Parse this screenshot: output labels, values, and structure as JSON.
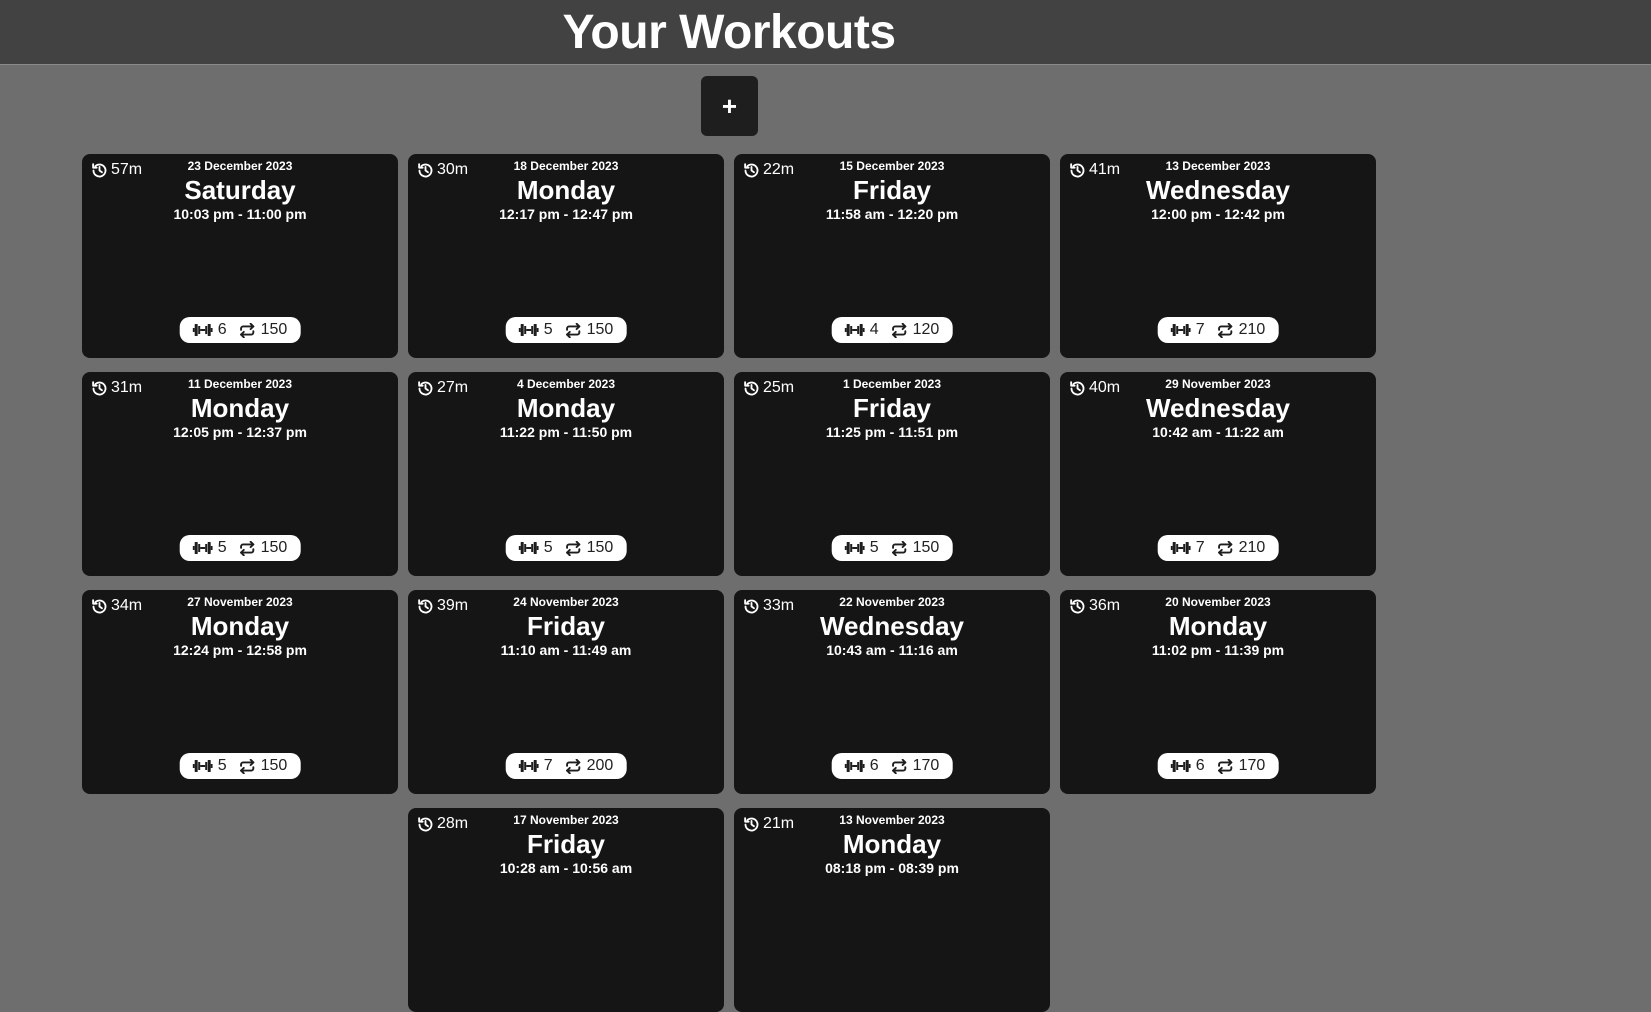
{
  "header": {
    "title": "Your Workouts"
  },
  "add_button": {
    "label": "+"
  },
  "colors": {
    "page_bg": "#6e6e6e",
    "header_bg": "#424242",
    "card_bg": "#151515",
    "pill_bg": "#ffffff"
  },
  "icons": {
    "duration": "history-icon",
    "exercises": "dumbbell-icon",
    "reps": "repeat-icon"
  },
  "workouts": [
    {
      "duration": "57m",
      "date": "23 December 2023",
      "weekday": "Saturday",
      "time": "10:03 pm - 11:00 pm",
      "exercises": "6",
      "reps": "150"
    },
    {
      "duration": "30m",
      "date": "18 December 2023",
      "weekday": "Monday",
      "time": "12:17 pm - 12:47 pm",
      "exercises": "5",
      "reps": "150"
    },
    {
      "duration": "22m",
      "date": "15 December 2023",
      "weekday": "Friday",
      "time": "11:58 am - 12:20 pm",
      "exercises": "4",
      "reps": "120"
    },
    {
      "duration": "41m",
      "date": "13 December 2023",
      "weekday": "Wednesday",
      "time": "12:00 pm - 12:42 pm",
      "exercises": "7",
      "reps": "210"
    },
    {
      "duration": "31m",
      "date": "11 December 2023",
      "weekday": "Monday",
      "time": "12:05 pm - 12:37 pm",
      "exercises": "5",
      "reps": "150"
    },
    {
      "duration": "27m",
      "date": "4 December 2023",
      "weekday": "Monday",
      "time": "11:22 pm - 11:50 pm",
      "exercises": "5",
      "reps": "150"
    },
    {
      "duration": "25m",
      "date": "1 December 2023",
      "weekday": "Friday",
      "time": "11:25 pm - 11:51 pm",
      "exercises": "5",
      "reps": "150"
    },
    {
      "duration": "40m",
      "date": "29 November 2023",
      "weekday": "Wednesday",
      "time": "10:42 am - 11:22 am",
      "exercises": "7",
      "reps": "210"
    },
    {
      "duration": "34m",
      "date": "27 November 2023",
      "weekday": "Monday",
      "time": "12:24 pm - 12:58 pm",
      "exercises": "5",
      "reps": "150"
    },
    {
      "duration": "39m",
      "date": "24 November 2023",
      "weekday": "Friday",
      "time": "11:10 am - 11:49 am",
      "exercises": "7",
      "reps": "200"
    },
    {
      "duration": "33m",
      "date": "22 November 2023",
      "weekday": "Wednesday",
      "time": "10:43 am - 11:16 am",
      "exercises": "6",
      "reps": "170"
    },
    {
      "duration": "36m",
      "date": "20 November 2023",
      "weekday": "Monday",
      "time": "11:02 pm - 11:39 pm",
      "exercises": "6",
      "reps": "170"
    },
    {
      "duration": "28m",
      "date": "17 November 2023",
      "weekday": "Friday",
      "time": "10:28 am - 10:56 am",
      "exercises": "",
      "reps": ""
    },
    {
      "duration": "21m",
      "date": "13 November 2023",
      "weekday": "Monday",
      "time": "08:18 pm - 08:39 pm",
      "exercises": "",
      "reps": ""
    }
  ]
}
